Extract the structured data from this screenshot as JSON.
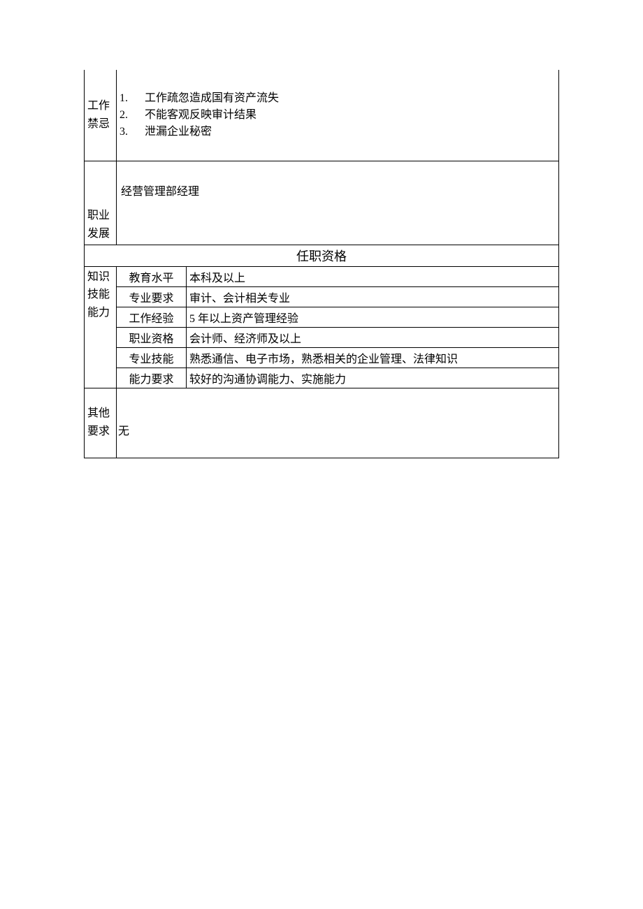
{
  "sections": {
    "taboo": {
      "label": "工作禁忌",
      "items": [
        {
          "num": "1.",
          "text": "工作疏忽造成国有资产流失"
        },
        {
          "num": "2.",
          "text": "不能客观反映审计结果"
        },
        {
          "num": "3.",
          "text": "泄漏企业秘密"
        }
      ]
    },
    "career": {
      "label": "职业发展",
      "value": "经营管理部经理"
    },
    "qualification": {
      "header": "任职资格",
      "group_label": "知识技能能力",
      "rows": [
        {
          "label": "教育水平",
          "value": "本科及以上"
        },
        {
          "label": "专业要求",
          "value": "审计、会计相关专业"
        },
        {
          "label": "工作经验",
          "value": "5 年以上资产管理经验"
        },
        {
          "label": "职业资格",
          "value": "会计师、经济师及以上"
        },
        {
          "label": "专业技能",
          "value": "熟悉通信、电子市场，熟悉相关的企业管理、法律知识"
        },
        {
          "label": "能力要求",
          "value": "较好的沟通协调能力、实施能力"
        }
      ]
    },
    "other": {
      "label": "其他要求",
      "value": "无"
    }
  }
}
